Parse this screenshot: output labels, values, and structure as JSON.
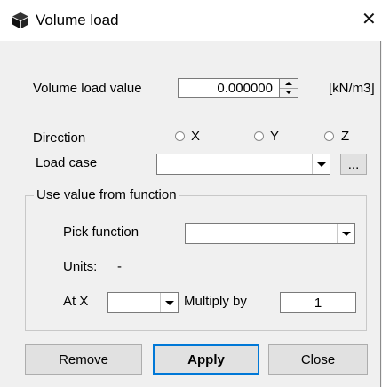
{
  "window": {
    "title": "Volume load",
    "close_glyph": "✕",
    "icon": "cube-icon"
  },
  "volume_load": {
    "label": "Volume load value",
    "value": "0.000000",
    "unit": "[kN/m3]"
  },
  "direction": {
    "label": "Direction",
    "options": [
      {
        "label": "X",
        "selected": false
      },
      {
        "label": "Y",
        "selected": false
      },
      {
        "label": "Z",
        "selected": false
      }
    ]
  },
  "load_case": {
    "label": "Load case",
    "value": "",
    "browse_label": "..."
  },
  "function_group": {
    "caption": "Use value from function",
    "pick_function_label": "Pick function",
    "pick_function_value": "",
    "units_label": "Units:",
    "units_value": "-",
    "at_x_label": "At X",
    "at_x_value": "",
    "multiply_label": "Multiply by",
    "multiply_value": "1"
  },
  "buttons": {
    "remove": "Remove",
    "apply": "Apply",
    "close": "Close"
  },
  "colors": {
    "background": "#f0f0f0",
    "titlebar": "#ffffff",
    "default_button_border": "#0078d7"
  }
}
